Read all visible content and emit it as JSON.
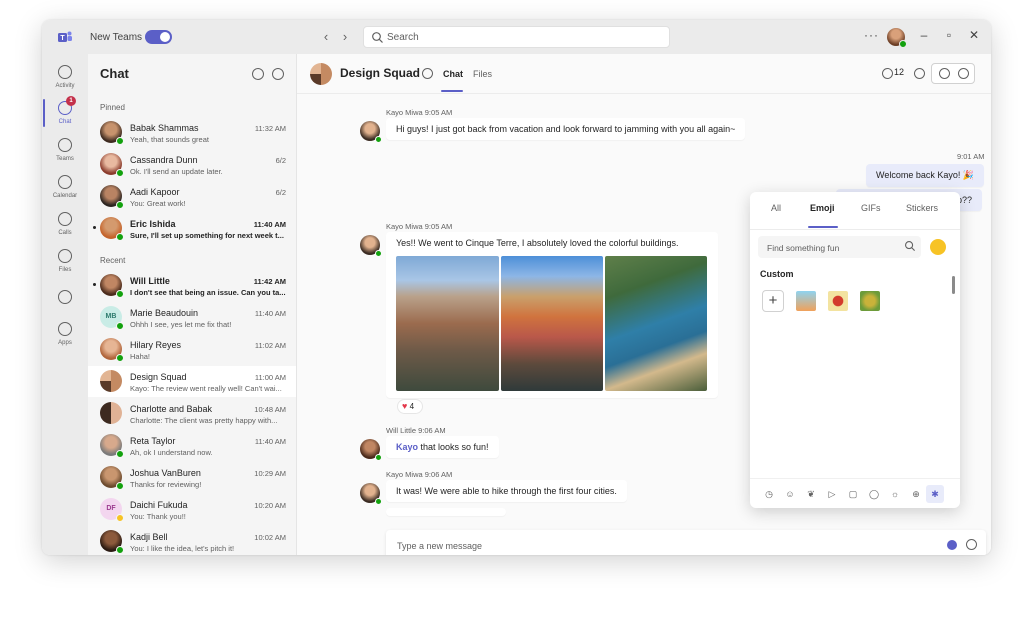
{
  "titlebar": {
    "new_teams_label": "New Teams",
    "new_teams_enabled": true,
    "search_placeholder": "Search",
    "more_label": "···",
    "back_icon": "chevron-left-icon",
    "forward_icon": "chevron-right-icon"
  },
  "rail": {
    "items": [
      {
        "label": "Activity",
        "icon": "bell-icon"
      },
      {
        "label": "Chat",
        "icon": "chat-icon",
        "badge": "1",
        "active": true
      },
      {
        "label": "Teams",
        "icon": "teams-icon"
      },
      {
        "label": "Calendar",
        "icon": "calendar-icon"
      },
      {
        "label": "Calls",
        "icon": "phone-icon"
      },
      {
        "label": "Files",
        "icon": "files-icon"
      },
      {
        "label": "",
        "icon": "more-apps-icon"
      },
      {
        "label": "Apps",
        "icon": "apps-icon"
      }
    ]
  },
  "chatlist": {
    "title": "Chat",
    "pinned_label": "Pinned",
    "recent_label": "Recent",
    "pinned": [
      {
        "name": "Babak Shammas",
        "preview": "Yeah, that sounds great",
        "time": "11:32 AM",
        "unread": false
      },
      {
        "name": "Cassandra Dunn",
        "preview": "Ok. I'll send an update later.",
        "time": "6/2",
        "unread": false
      },
      {
        "name": "Aadi Kapoor",
        "preview": "You: Great work!",
        "time": "6/2",
        "unread": false
      },
      {
        "name": "Eric Ishida",
        "preview": "Sure, I'll set up something for next week t...",
        "time": "11:40 AM",
        "unread": true
      }
    ],
    "recent": [
      {
        "name": "Will Little",
        "preview": "I don't see that being an issue. Can you ta...",
        "time": "11:42 AM",
        "unread": true
      },
      {
        "name": "Marie Beaudouin",
        "initials": "MB",
        "preview": "Ohhh I see, yes let me fix that!",
        "time": "11:40 AM",
        "unread": false
      },
      {
        "name": "Hilary Reyes",
        "preview": "Haha!",
        "time": "11:02 AM",
        "unread": false
      },
      {
        "name": "Design Squad",
        "preview": "Kayo: The review went really well! Can't wai...",
        "time": "11:00 AM",
        "unread": false,
        "selected": true
      },
      {
        "name": "Charlotte and Babak",
        "preview": "Charlotte: The client was pretty happy with...",
        "time": "10:48 AM",
        "unread": false
      },
      {
        "name": "Reta Taylor",
        "preview": "Ah, ok I understand now.",
        "time": "11:40 AM",
        "unread": false
      },
      {
        "name": "Joshua VanBuren",
        "preview": "Thanks for reviewing!",
        "time": "10:29 AM",
        "unread": false
      },
      {
        "name": "Daichi Fukuda",
        "initials": "DF",
        "preview": "You: Thank you!!",
        "time": "10:20 AM",
        "unread": false
      },
      {
        "name": "Kadji Bell",
        "preview": "You: I like the idea, let's pitch it!",
        "time": "10:02 AM",
        "unread": false
      }
    ]
  },
  "conversation": {
    "title": "Design Squad",
    "tabs": [
      "Chat",
      "Files"
    ],
    "participants_count": "12",
    "messages": {
      "m1_meta": "Kayo Miwa  9:05 AM",
      "m1_text": "Hi guys! I just got back from vacation and look forward to jamming with you all again~",
      "mine_time": "9:01 AM",
      "mine_1": "Welcome back Kayo! 🎉",
      "mine_2": "Any cool sights from your trip??",
      "m2_meta": "Kayo Miwa  9:05 AM",
      "m2_text": "Yes!! We went to Cinque Terre, I absolutely loved the colorful buildings.",
      "reaction_count": "4",
      "m3_meta": "Will Little  9:06 AM",
      "m3_mention": "Kayo",
      "m3_text": " that looks so fun!",
      "m4_meta": "Kayo Miwa  9:06 AM",
      "m4_text": "It was! We were able to hike through the first four cities."
    },
    "compose_placeholder": "Type a new message"
  },
  "emoji_picker": {
    "tabs": [
      "All",
      "Emoji",
      "GIFs",
      "Stickers"
    ],
    "active_tab": "Emoji",
    "search_placeholder": "Find something fun",
    "custom_label": "Custom",
    "add_label": "+",
    "categories": [
      "recent-icon",
      "smiley-icon",
      "animal-icon",
      "food-icon",
      "activity-icon",
      "travel-icon",
      "objects-icon",
      "symbols-icon",
      "flags-icon",
      "custom-icon"
    ]
  },
  "colors": {
    "accent": "#5b5fc7",
    "presence_available": "#13a10e",
    "badge": "#c4314b"
  }
}
